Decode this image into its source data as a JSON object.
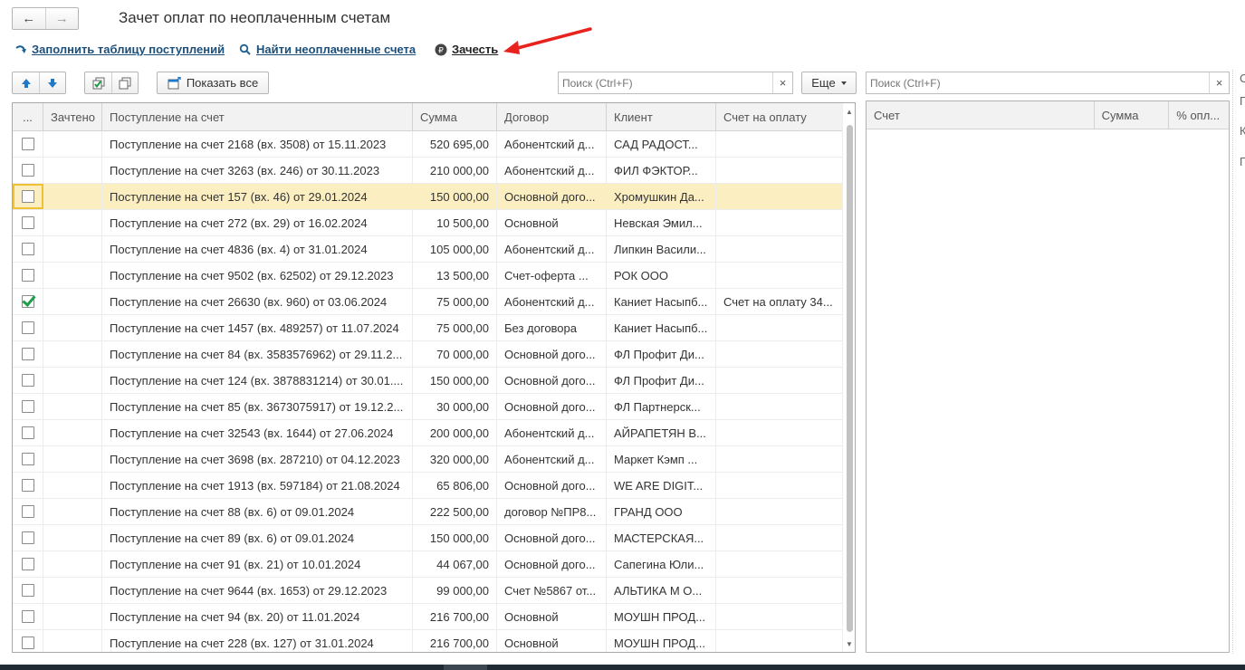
{
  "header": {
    "back_glyph": "←",
    "forward_glyph": "→",
    "title": "Зачет оплат по неоплаченным счетам"
  },
  "commands": {
    "fill_table": "Заполнить таблицу поступлений",
    "find_unpaid": "Найти неоплаченные счета",
    "offset": "Зачесть"
  },
  "toolbar": {
    "show_all": "Показать все",
    "search_placeholder": "Поиск (Ctrl+F)",
    "more": "Еще",
    "clear_glyph": "×"
  },
  "table": {
    "columns": [
      "...",
      "Зачтено",
      "Поступление на счет",
      "Сумма",
      "Договор",
      "Клиент",
      "Счет на оплату"
    ],
    "rows": [
      {
        "checked": false,
        "selected": false,
        "zachteno": "",
        "receipt": "Поступление на счет 2168 (вх. 3508) от 15.11.2023",
        "sum": "520 695,00",
        "contract": "Абонентский д...",
        "client": "САД РАДОСТ...",
        "invoice": ""
      },
      {
        "checked": false,
        "selected": false,
        "zachteno": "",
        "receipt": "Поступление на счет 3263 (вх. 246) от 30.11.2023",
        "sum": "210 000,00",
        "contract": "Абонентский д...",
        "client": "ФИЛ ФЭКТОР...",
        "invoice": ""
      },
      {
        "checked": false,
        "selected": true,
        "zachteno": "",
        "receipt": "Поступление на счет 157 (вх. 46) от 29.01.2024",
        "sum": "150 000,00",
        "contract": "Основной дого...",
        "client": "Хромушкин Да...",
        "invoice": ""
      },
      {
        "checked": false,
        "selected": false,
        "zachteno": "",
        "receipt": "Поступление на счет 272 (вх. 29) от 16.02.2024",
        "sum": "10 500,00",
        "contract": "Основной",
        "client": "Невская Эмил...",
        "invoice": ""
      },
      {
        "checked": false,
        "selected": false,
        "zachteno": "",
        "receipt": "Поступление на счет 4836 (вх. 4) от 31.01.2024",
        "sum": "105 000,00",
        "contract": "Абонентский д...",
        "client": "Липкин Васили...",
        "invoice": ""
      },
      {
        "checked": false,
        "selected": false,
        "zachteno": "",
        "receipt": "Поступление на счет 9502 (вх. 62502) от 29.12.2023",
        "sum": "13 500,00",
        "contract": "Счет-оферта ...",
        "client": "РОК ООО",
        "invoice": ""
      },
      {
        "checked": true,
        "selected": false,
        "zachteno": "",
        "receipt": "Поступление на счет 26630 (вх. 960) от 03.06.2024",
        "sum": "75 000,00",
        "contract": "Абонентский д...",
        "client": "Каниет Насыпб...",
        "invoice": "Счет на оплату 34..."
      },
      {
        "checked": false,
        "selected": false,
        "zachteno": "",
        "receipt": "Поступление на счет 1457 (вх. 489257) от 11.07.2024",
        "sum": "75 000,00",
        "contract": "Без договора",
        "client": "Каниет Насыпб...",
        "invoice": ""
      },
      {
        "checked": false,
        "selected": false,
        "zachteno": "",
        "receipt": "Поступление на счет 84 (вх. 3583576962) от 29.11.2...",
        "sum": "70 000,00",
        "contract": "Основной дого...",
        "client": "ФЛ Профит Ди...",
        "invoice": ""
      },
      {
        "checked": false,
        "selected": false,
        "zachteno": "",
        "receipt": "Поступление на счет 124 (вх. 3878831214) от 30.01....",
        "sum": "150 000,00",
        "contract": "Основной дого...",
        "client": "ФЛ Профит Ди...",
        "invoice": ""
      },
      {
        "checked": false,
        "selected": false,
        "zachteno": "",
        "receipt": "Поступление на счет 85 (вх. 3673075917) от 19.12.2...",
        "sum": "30 000,00",
        "contract": "Основной дого...",
        "client": "ФЛ Партнерск...",
        "invoice": ""
      },
      {
        "checked": false,
        "selected": false,
        "zachteno": "",
        "receipt": "Поступление на счет 32543 (вх. 1644) от 27.06.2024",
        "sum": "200 000,00",
        "contract": "Абонентский д...",
        "client": "АЙРАПЕТЯН В...",
        "invoice": ""
      },
      {
        "checked": false,
        "selected": false,
        "zachteno": "",
        "receipt": "Поступление на счет 3698 (вх. 287210) от 04.12.2023",
        "sum": "320 000,00",
        "contract": "Абонентский д...",
        "client": "Маркет Кэмп ...",
        "invoice": ""
      },
      {
        "checked": false,
        "selected": false,
        "zachteno": "",
        "receipt": "Поступление на счет 1913 (вх. 597184) от 21.08.2024",
        "sum": "65 806,00",
        "contract": "Основной дого...",
        "client": "WE ARE DIGIT...",
        "invoice": ""
      },
      {
        "checked": false,
        "selected": false,
        "zachteno": "",
        "receipt": "Поступление на счет 88 (вх. 6) от 09.01.2024",
        "sum": "222 500,00",
        "contract": "договор №ПР8...",
        "client": "ГРАНД ООО",
        "invoice": ""
      },
      {
        "checked": false,
        "selected": false,
        "zachteno": "",
        "receipt": "Поступление на счет 89 (вх. 6) от 09.01.2024",
        "sum": "150 000,00",
        "contract": "Основной дого...",
        "client": "МАСТЕРСКАЯ...",
        "invoice": ""
      },
      {
        "checked": false,
        "selected": false,
        "zachteno": "",
        "receipt": "Поступление на счет 91 (вх. 21) от 10.01.2024",
        "sum": "44 067,00",
        "contract": "Основной дого...",
        "client": "Сапегина Юли...",
        "invoice": ""
      },
      {
        "checked": false,
        "selected": false,
        "zachteno": "",
        "receipt": "Поступление на счет 9644 (вх. 1653) от 29.12.2023",
        "sum": "99 000,00",
        "contract": "Счет №5867 от...",
        "client": "АЛЬТИКА М О...",
        "invoice": ""
      },
      {
        "checked": false,
        "selected": false,
        "zachteno": "",
        "receipt": "Поступление на счет 94 (вх. 20) от 11.01.2024",
        "sum": "216 700,00",
        "contract": "Основной",
        "client": "МОУШН ПРОД...",
        "invoice": ""
      },
      {
        "checked": false,
        "selected": false,
        "zachteno": "",
        "receipt": "Поступление на счет 228 (вх. 127) от 31.01.2024",
        "sum": "216 700,00",
        "contract": "Основной",
        "client": "МОУШН ПРОД...",
        "invoice": ""
      }
    ]
  },
  "right_panel": {
    "search_placeholder": "Поиск (Ctrl+F)",
    "columns": [
      "Счет",
      "Сумма",
      "% опл..."
    ],
    "side_letters": [
      "С",
      "П",
      "К",
      "П"
    ]
  },
  "colors": {
    "selected_row": "#fbeec0",
    "selected_border": "#f0c233",
    "link": "#1c4f7a",
    "checkmark": "#1e9e48",
    "arrow": "#e8231e",
    "nav_arrow_blue": "#1f79c8"
  },
  "icons": [
    "back-arrow-icon",
    "forward-arrow-icon",
    "fill-arrow-icon",
    "search-icon",
    "ruble-icon",
    "move-up-icon",
    "move-down-icon",
    "check-all-icon",
    "uncheck-all-icon",
    "show-all-icon",
    "dropdown-caret-icon",
    "red-pointer-arrow"
  ]
}
